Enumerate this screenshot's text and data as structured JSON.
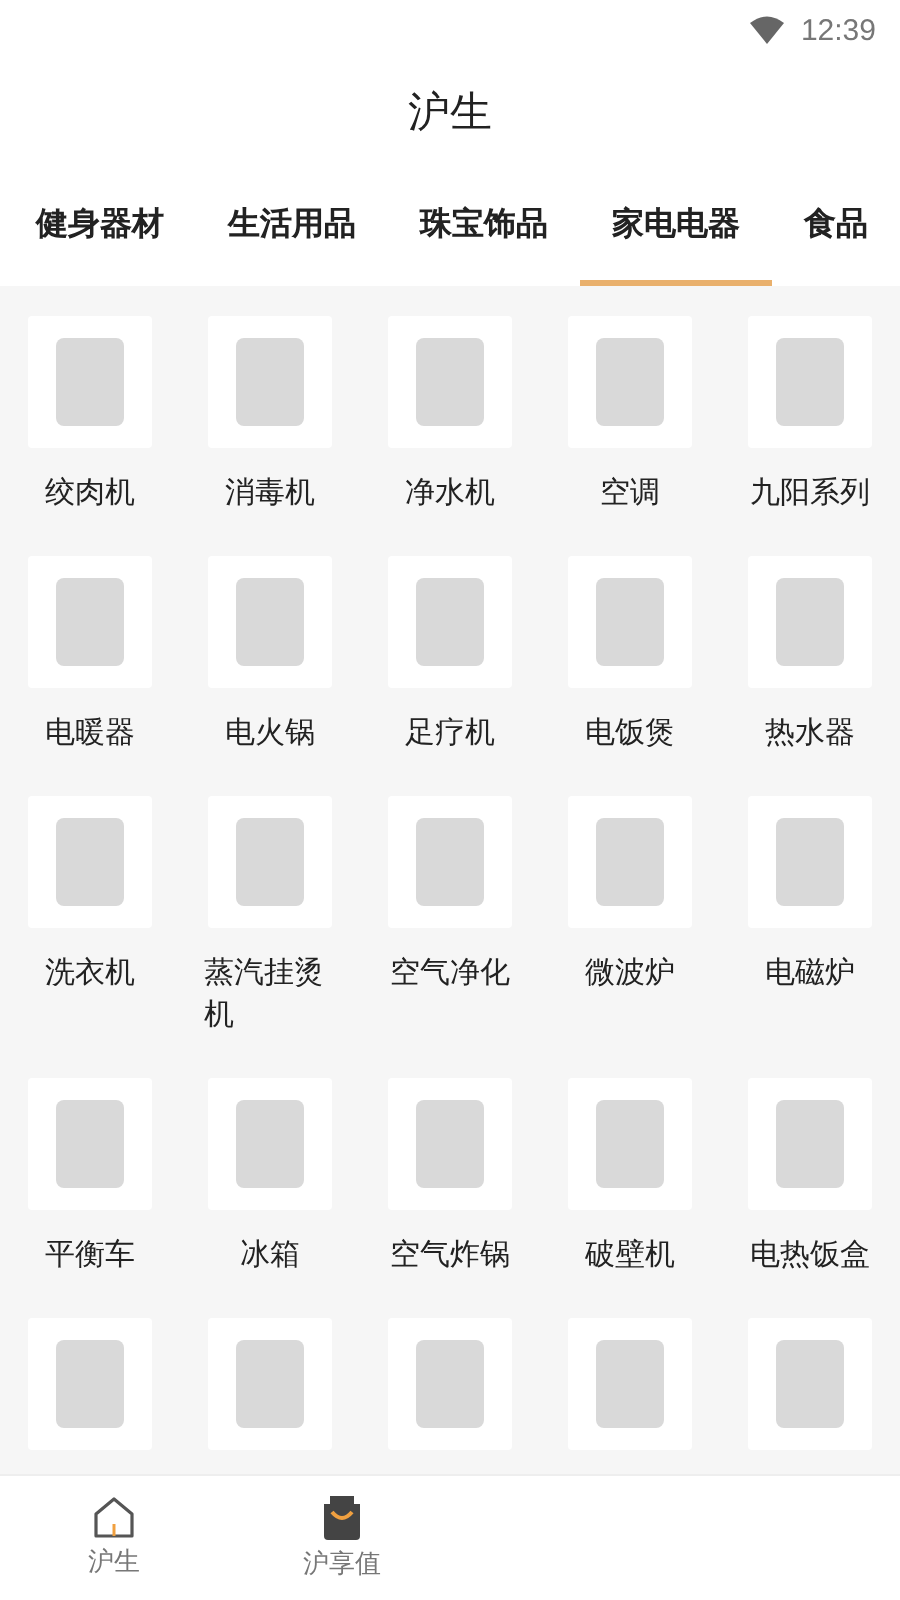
{
  "status_bar": {
    "time": "12:39"
  },
  "header": {
    "title": "沪生"
  },
  "tabs": [
    {
      "label": "健身器材",
      "selected": false
    },
    {
      "label": "生活用品",
      "selected": false
    },
    {
      "label": "珠宝饰品",
      "selected": false
    },
    {
      "label": "家电电器",
      "selected": true
    },
    {
      "label": "食品",
      "selected": false
    }
  ],
  "products": [
    {
      "label": "绞肉机"
    },
    {
      "label": "消毒机"
    },
    {
      "label": "净水机"
    },
    {
      "label": "空调"
    },
    {
      "label": "九阳系列"
    },
    {
      "label": "电暖器"
    },
    {
      "label": "电火锅"
    },
    {
      "label": "足疗机"
    },
    {
      "label": "电饭煲"
    },
    {
      "label": "热水器"
    },
    {
      "label": "洗衣机"
    },
    {
      "label": "蒸汽挂烫机"
    },
    {
      "label": "空气净化"
    },
    {
      "label": "微波炉"
    },
    {
      "label": "电磁炉"
    },
    {
      "label": "平衡车"
    },
    {
      "label": "冰箱"
    },
    {
      "label": "空气炸锅"
    },
    {
      "label": "破壁机"
    },
    {
      "label": "电热饭盒"
    },
    {
      "kind": "photo_only"
    },
    {
      "kind": "photo_only"
    },
    {
      "kind": "photo_only"
    },
    {
      "kind": "photo_only"
    },
    {
      "kind": "photo_only"
    }
  ],
  "bottom_nav": [
    {
      "kind": "home",
      "label": "沪生"
    },
    {
      "kind": "bag",
      "label": "沪享值"
    }
  ]
}
